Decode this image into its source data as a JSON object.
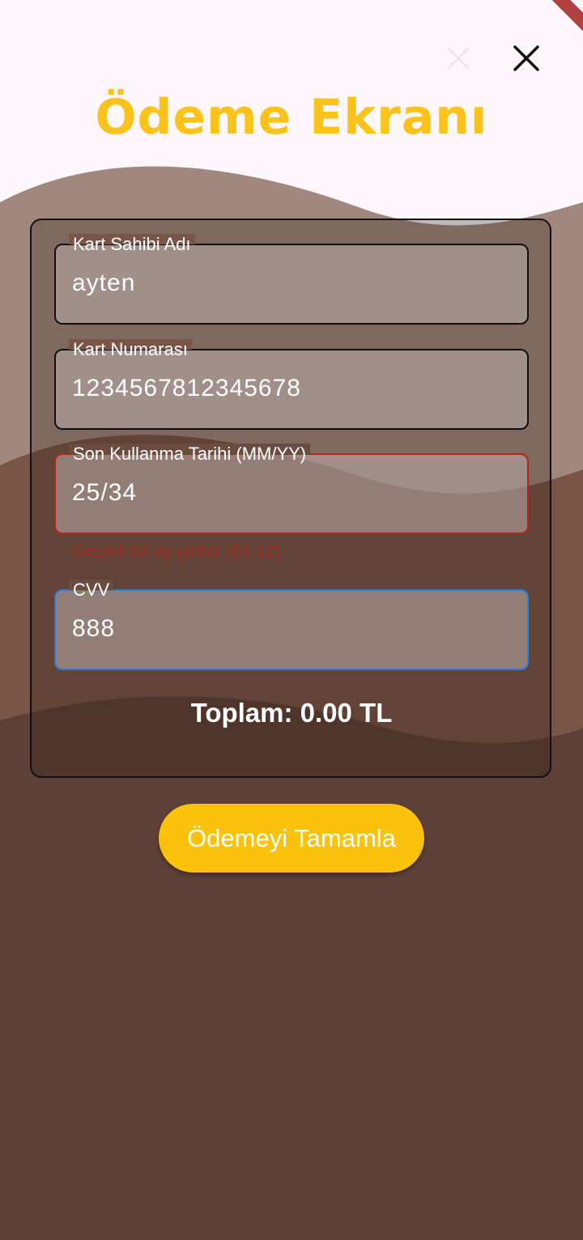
{
  "header": {
    "title": "Ödeme Ekranı",
    "close_icon": "close-icon",
    "faint_close_icon": "close-icon"
  },
  "form": {
    "fields": [
      {
        "label": "Kart Sahibi Adı",
        "value": "ayten",
        "state": "normal"
      },
      {
        "label": "Kart Numarası",
        "value": "1234567812345678",
        "state": "normal"
      },
      {
        "label": "Son Kullanma Tarihi (MM/YY)",
        "value": "25/34",
        "state": "error",
        "error": "Geçerli bir ay giriniz (01-12)"
      },
      {
        "label": "CVV",
        "value": "888",
        "state": "focused"
      }
    ],
    "total": "Toplam: 0.00 TL"
  },
  "actions": {
    "pay_label": "Ödemeyi Tamamla"
  },
  "colors": {
    "accent": "#fbc21a",
    "background_top": "#fdf7fc",
    "background_bottom": "#5d4037",
    "error": "#b3261e",
    "focus": "#2f7bd6"
  }
}
